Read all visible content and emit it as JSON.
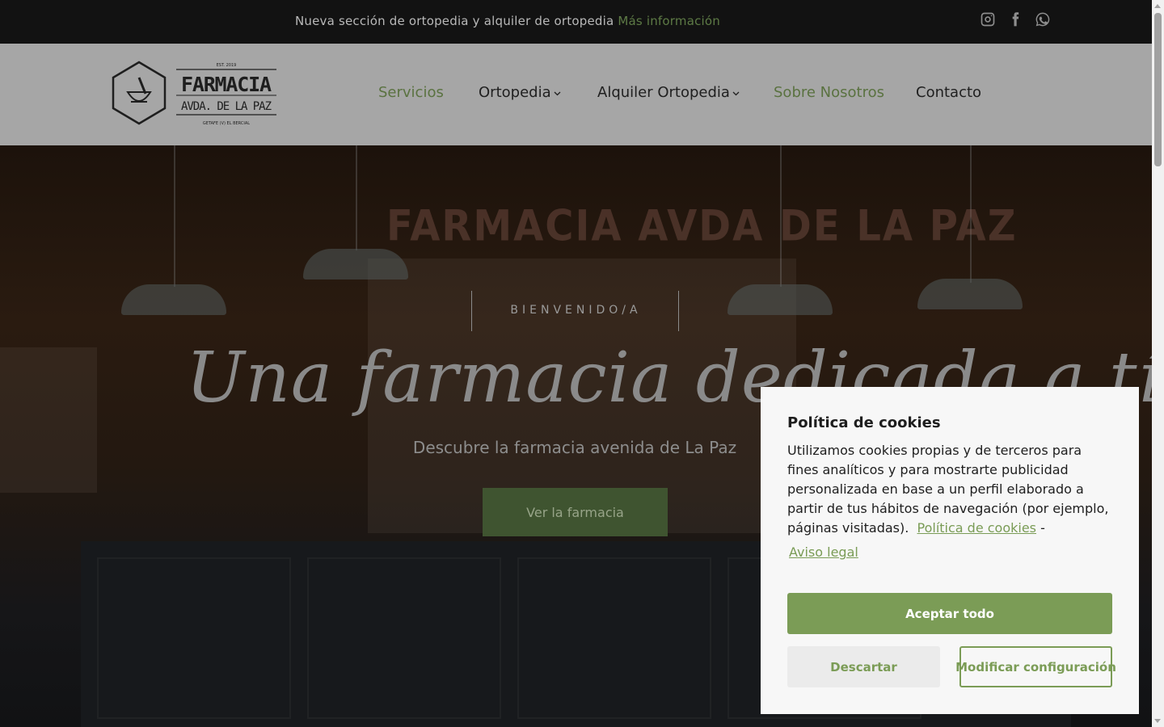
{
  "topbar": {
    "message": "Nueva sección de ortopedia y alquiler de ortopedia",
    "more_link": "Más información",
    "social": [
      "instagram-icon",
      "facebook-icon",
      "whatsapp-icon"
    ]
  },
  "logo": {
    "est": "EST. 2019",
    "line1": "FARMACIA",
    "line2": "AVDA. DE LA PAZ",
    "location": "GETAFE (V) EL BERCIAL"
  },
  "nav": {
    "items": [
      {
        "label": "Servicios",
        "active": true
      },
      {
        "label": "Ortopedia",
        "dropdown": true
      },
      {
        "label": "Alquiler Ortopedia",
        "dropdown": true
      },
      {
        "label": "Sobre Nosotros",
        "active": true
      },
      {
        "label": "Contacto"
      }
    ]
  },
  "hero": {
    "sign_text": "FARMACIA AVDA DE LA PAZ",
    "welcome": "BIENVENIDO/A",
    "tagline": "Una farmacia dedicada a tí",
    "subline": "Descubre la farmacia avenida de La Paz",
    "cta": "Ver la farmacia"
  },
  "cookie": {
    "title": "Política de cookies",
    "body": "Utilizamos cookies propias y de terceros para fines analíticos y para mostrarte publicidad personalizada en base a un perfil elaborado a partir de tus hábitos de navegación (por ejemplo, páginas visitadas).",
    "policy_link": "Política de cookies",
    "separator": "-",
    "legal_link": "Aviso legal",
    "accept": "Aceptar todo",
    "dismiss": "Descartar",
    "configure": "Modificar configuración"
  },
  "colors": {
    "accent_green": "#7b9c56",
    "topbar_bg": "#121212",
    "header_bg": "#a6a6a6"
  }
}
